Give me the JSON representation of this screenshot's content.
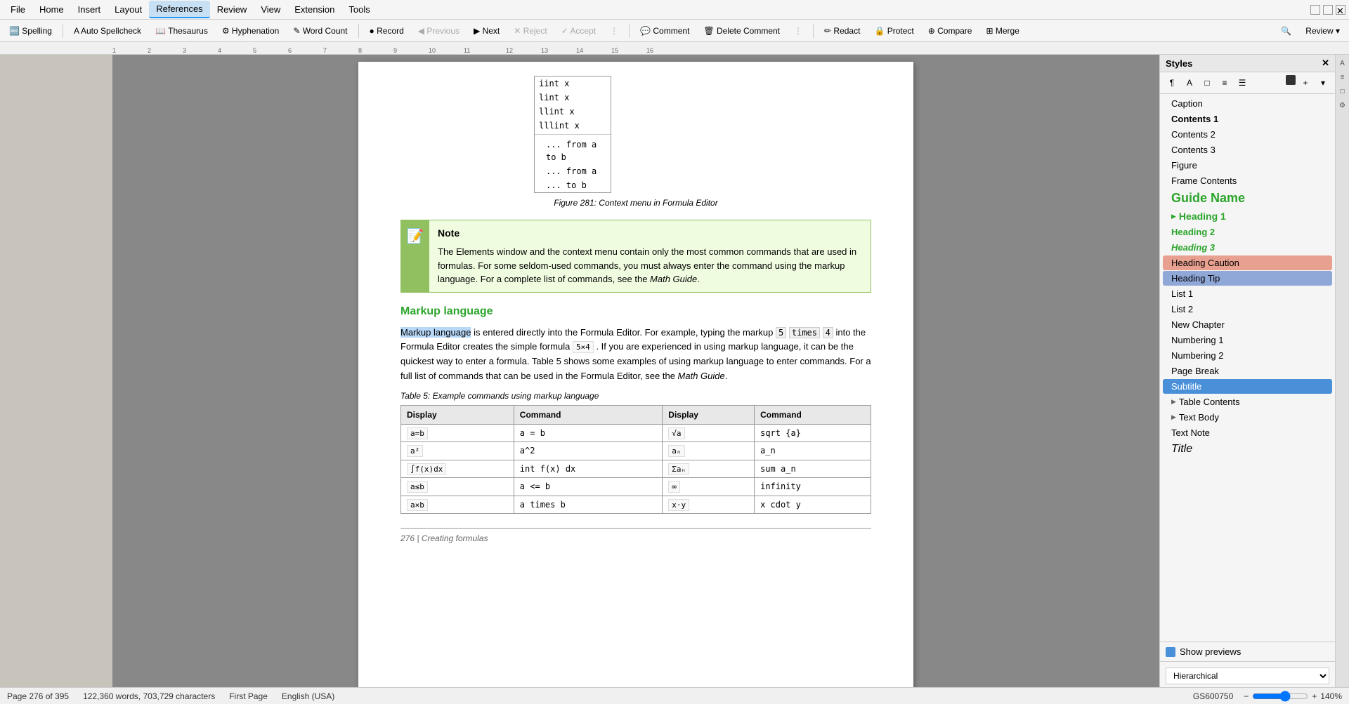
{
  "titlebar": {
    "icons": [
      "file-open",
      "save",
      "undo",
      "redo",
      "print"
    ]
  },
  "menubar": {
    "items": [
      "File",
      "Home",
      "Insert",
      "Layout",
      "References",
      "Review",
      "View",
      "Extension",
      "Tools"
    ],
    "active": "References"
  },
  "toolbar": {
    "buttons": [
      {
        "label": "🔤 Spelling",
        "name": "spelling-btn"
      },
      {
        "label": "A Auto Spellcheck",
        "name": "autospellcheck-btn"
      },
      {
        "label": "📖 Thesaurus",
        "name": "thesaurus-btn"
      },
      {
        "label": "⚙ Hyphenation",
        "name": "hyphenation-btn"
      },
      {
        "label": "✎ Word Count",
        "name": "wordcount-btn"
      },
      {
        "label": "● Record",
        "name": "record-btn"
      },
      {
        "label": "◀ Previous",
        "name": "previous-btn"
      },
      {
        "label": "▶ Next",
        "name": "next-btn"
      },
      {
        "label": "✕ Reject",
        "name": "reject-btn"
      },
      {
        "label": "✓ Accept",
        "name": "accept-btn"
      },
      {
        "label": "💬 Comment",
        "name": "comment-btn"
      },
      {
        "label": "🗑 Delete Comment",
        "name": "delete-comment-btn"
      },
      {
        "label": "✏ Redact",
        "name": "redact-btn"
      },
      {
        "label": "🔒 Protect",
        "name": "protect-btn"
      },
      {
        "label": "⊕ Compare",
        "name": "compare-btn"
      },
      {
        "label": "⊞ Merge",
        "name": "merge-btn"
      },
      {
        "label": "Review ▾",
        "name": "review-dropdown-btn"
      }
    ]
  },
  "document": {
    "formula_dropdown": {
      "items": [
        "iint x",
        "lint x",
        "llint x",
        "lllint x"
      ],
      "separator_items": [
        "... from a to b",
        "... from a",
        "... to b"
      ]
    },
    "figure_caption": "Figure 281: Context menu in Formula Editor",
    "note": {
      "title": "Note",
      "text": "The Elements window and the context menu contain only the most common commands that are used in formulas. For some seldom-used commands, you must always enter the command using the markup language. For a complete list of commands, see the Math Guide."
    },
    "section_heading": "Markup language",
    "body_text1": "Markup language is entered directly into the Formula Editor. For example, typing the markup 5 times 4 into the Formula Editor creates the simple formula 5×4. If you are experienced in using markup language, it can be the quickest way to enter a formula. Table 5 shows some examples of using markup language to enter commands. For a full list of commands that can be used in the Formula Editor, see the Math Guide.",
    "table_caption": "Table 5: Example commands using markup language",
    "table": {
      "headers": [
        "Display",
        "Command",
        "Display",
        "Command"
      ],
      "rows": [
        [
          "a=b",
          "a = b",
          "√a",
          "sqrt {a}"
        ],
        [
          "a²",
          "a^2",
          "aₙ",
          "a_n"
        ],
        [
          "∫f(x)dx",
          "int f(x) dx",
          "Σaₙ",
          "sum a_n"
        ],
        [
          "a≤b",
          "a <= b",
          "∞",
          "infinity"
        ],
        [
          "a×b",
          "a times b",
          "x·y",
          "x cdot y"
        ]
      ]
    },
    "footer_text": "276 | Creating formulas"
  },
  "styles_panel": {
    "title": "Styles",
    "items": [
      {
        "label": "Caption",
        "type": "normal",
        "expandable": false
      },
      {
        "label": "Contents 1",
        "type": "bold",
        "expandable": false
      },
      {
        "label": "Contents 2",
        "type": "normal",
        "expandable": false
      },
      {
        "label": "Contents 3",
        "type": "normal",
        "expandable": false
      },
      {
        "label": "Figure",
        "type": "normal",
        "expandable": false
      },
      {
        "label": "Frame Contents",
        "type": "normal",
        "expandable": false
      },
      {
        "label": "Guide Name",
        "type": "guide-name",
        "expandable": false
      },
      {
        "label": "Heading 1",
        "type": "heading1",
        "expandable": true
      },
      {
        "label": "Heading 2",
        "type": "heading2",
        "expandable": false
      },
      {
        "label": "Heading 3",
        "type": "heading3",
        "expandable": false
      },
      {
        "label": "Heading Caution",
        "type": "heading-caution",
        "expandable": false
      },
      {
        "label": "Heading Tip",
        "type": "heading-tip",
        "expandable": false
      },
      {
        "label": "List 1",
        "type": "normal",
        "expandable": false
      },
      {
        "label": "List 2",
        "type": "normal",
        "expandable": false
      },
      {
        "label": "New Chapter",
        "type": "normal",
        "expandable": false
      },
      {
        "label": "Numbering 1",
        "type": "normal",
        "expandable": false
      },
      {
        "label": "Numbering 2",
        "type": "normal",
        "expandable": false
      },
      {
        "label": "Page Break",
        "type": "normal",
        "expandable": false
      },
      {
        "label": "Subtitle",
        "type": "subtitle",
        "active": true,
        "expandable": false
      },
      {
        "label": "Table Contents",
        "type": "normal",
        "expandable": true
      },
      {
        "label": "Text Body",
        "type": "normal",
        "expandable": true
      },
      {
        "label": "Text Note",
        "type": "normal",
        "expandable": false
      },
      {
        "label": "Title",
        "type": "title",
        "expandable": false
      }
    ],
    "show_previews": "Show previews",
    "hierarchical_label": "Hierarchical"
  },
  "statusbar": {
    "page_info": "Page 276 of 395",
    "word_count": "122,360 words, 703,729 characters",
    "page_label": "First Page",
    "language": "English (USA)",
    "doc_id": "GS600750",
    "zoom": "140%"
  }
}
